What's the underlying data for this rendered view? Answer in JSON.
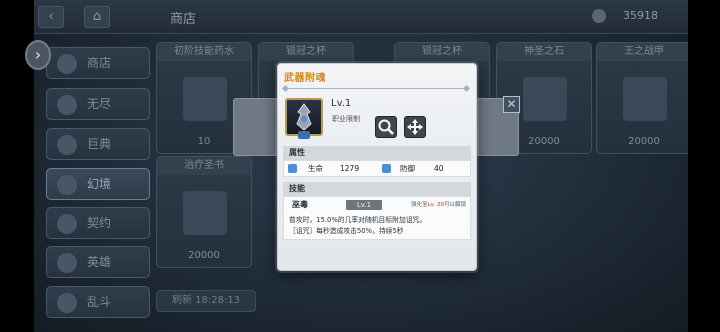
{
  "topbar": {
    "back_icon": "back-arrow-icon",
    "home_icon": "home-icon",
    "title": "商店",
    "currency": "35918"
  },
  "nav": [
    {
      "label": "商店",
      "icon": "shop-icon"
    },
    {
      "label": "无尽",
      "icon": "endless-icon"
    },
    {
      "label": "巨典",
      "icon": "book-icon"
    },
    {
      "label": "幻境",
      "icon": "realm-icon"
    },
    {
      "label": "契约",
      "icon": "contract-icon"
    },
    {
      "label": "英雄",
      "icon": "hero-icon"
    },
    {
      "label": "乱斗",
      "icon": "brawl-icon"
    }
  ],
  "cards": [
    {
      "title": "初阶技能药水",
      "price": "10"
    },
    {
      "title": "银冠之杯",
      "price": ""
    },
    {
      "title": "银冠之杯",
      "price": ""
    },
    {
      "title": "神圣之石",
      "price": "20000"
    },
    {
      "title": "王之战甲",
      "price": "20000"
    },
    {
      "title": "治疗圣书",
      "price": "20000"
    }
  ],
  "refresh_text": "刷新 18:28:13",
  "dialog": {
    "title": "武器附魂",
    "level": "Lv.1",
    "job_limit": "职业限制",
    "attributes_header": "属性",
    "stats": [
      {
        "label": "生命",
        "value": "1279"
      },
      {
        "label": "防御",
        "value": "40"
      }
    ],
    "skills_header": "技能",
    "skill": {
      "name": "巫毒",
      "level": "Lv.1",
      "note_prefix": "强化至",
      "note_level": "Lv. 20",
      "note_suffix": "可以解锁",
      "desc_line1": "普攻时，15.0%的几率对随机目标附加诅咒。",
      "desc_line2": "［诅咒］每秒造成攻击50%，持续5秒"
    }
  }
}
